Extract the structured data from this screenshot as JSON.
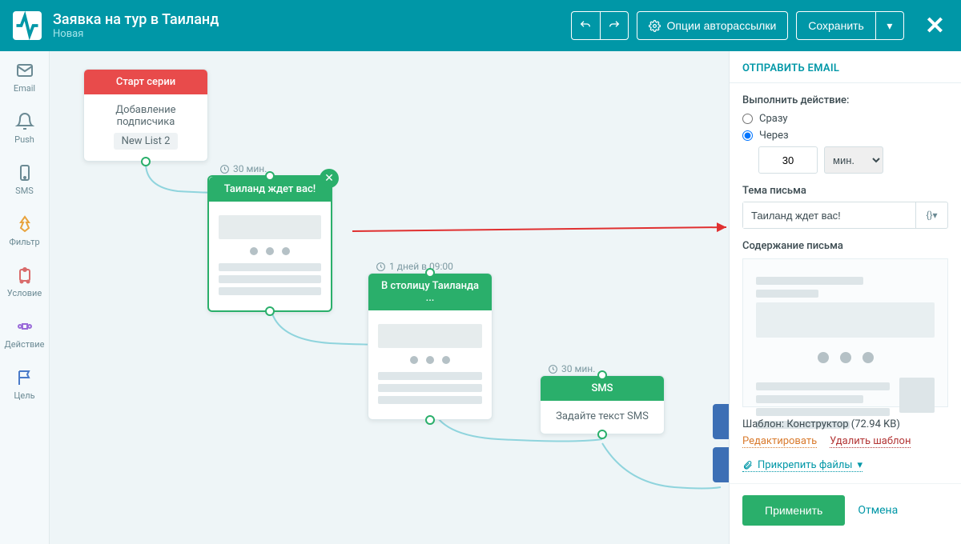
{
  "header": {
    "title": "Заявка на тур в Таиланд",
    "subtitle": "Новая",
    "options_label": "Опции авторассылки",
    "save_label": "Сохранить"
  },
  "sidebar": {
    "items": [
      {
        "label": "Email"
      },
      {
        "label": "Push"
      },
      {
        "label": "SMS"
      },
      {
        "label": "Фильтр"
      },
      {
        "label": "Условие"
      },
      {
        "label": "Действие"
      },
      {
        "label": "Цель"
      }
    ]
  },
  "canvas": {
    "start": {
      "title": "Старт серии",
      "line1": "Добавление подписчика",
      "tag": "New List 2"
    },
    "node1": {
      "title": "Таиланд ждет вас!",
      "delay": "30 мин."
    },
    "node2": {
      "title": "В столицу Таиланда ...",
      "delay": "1 дней в 09:00"
    },
    "node3": {
      "title": "SMS",
      "body": "Задайте текст SMS",
      "delay": "30 мин."
    }
  },
  "panel": {
    "title": "ОТПРАВИТЬ EMAIL",
    "action_label": "Выполнить действие:",
    "radio_now": "Сразу",
    "radio_delay": "Через",
    "delay_value": "30",
    "delay_unit": "мин.",
    "subject_label": "Тема письма",
    "subject_value": "Таиланд ждет вас!",
    "var_btn": "{}▾",
    "content_label": "Содержание письма",
    "template_prefix": "Шаблон:",
    "template_name": "Конструктор (72.94 KB)",
    "edit_link": "Редактировать",
    "delete_link": "Удалить шаблон",
    "attach_link": "Прикрепить файлы",
    "apply": "Применить",
    "cancel": "Отмена"
  }
}
